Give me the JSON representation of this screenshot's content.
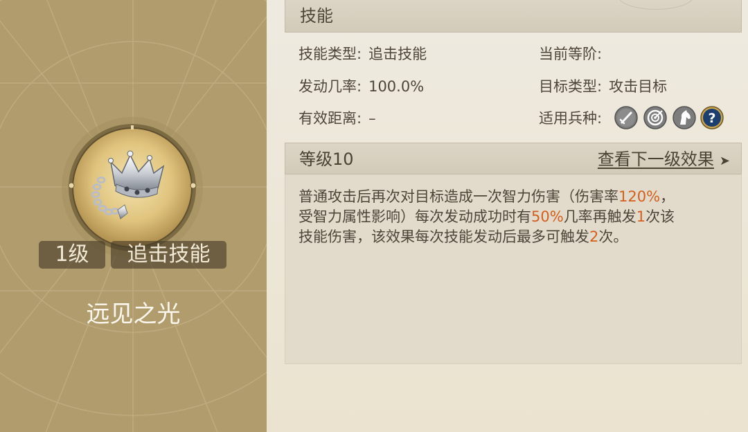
{
  "skill": {
    "name": "远见之光",
    "level_badge": "1级",
    "type_badge": "追击技能",
    "icon": "silver-crown-chain-icon"
  },
  "skills_section": {
    "title": "技能"
  },
  "attributes": {
    "skill_type": {
      "label": "技能类型:",
      "value": "追击技能"
    },
    "current_tier": {
      "label": "当前等阶:",
      "value": ""
    },
    "trigger_rate": {
      "label": "发动几率:",
      "value": "100.0%"
    },
    "target_type": {
      "label": "目标类型:",
      "value": "攻击目标"
    },
    "effective_range": {
      "label": "有效距离:",
      "value": "–"
    },
    "applicable_troops": {
      "label": "适用兵种:",
      "icons": [
        "sword-icon",
        "target-icon",
        "horse-icon",
        "question-icon"
      ]
    }
  },
  "level_section": {
    "title": "等级10",
    "next_link": "查看下一级效果",
    "next_arrow": "➤"
  },
  "description": {
    "line1_a": "普通攻击后再次对目标造成一次智力伤害（伤害率",
    "line1_hl": "120%",
    "line1_b": "，",
    "line2_a": "受智力属性影响）每次发动成功时有",
    "line2_hl1": "50%",
    "line2_b": "几率再触发",
    "line2_hl2": "1",
    "line2_c": "次该",
    "line3_a": "技能伤害，该效果每次技能发动后最多可触发",
    "line3_hl": "2",
    "line3_b": "次。"
  },
  "colors": {
    "left_panel": "#b19c6e",
    "highlight": "#d45e1c",
    "text": "#4e4538"
  }
}
